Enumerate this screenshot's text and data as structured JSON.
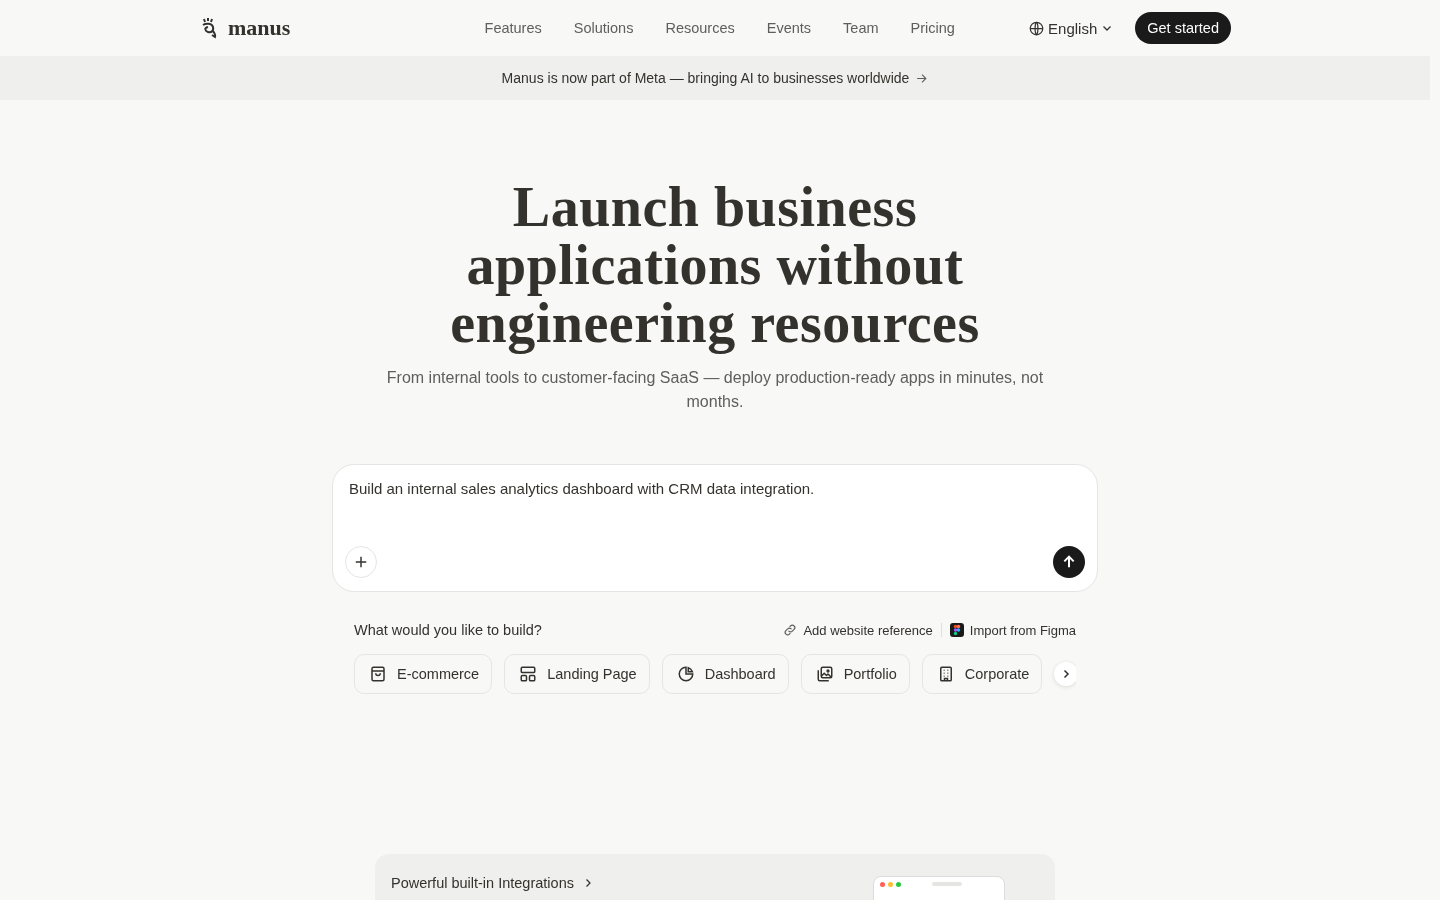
{
  "header": {
    "logo": "manus",
    "nav": [
      {
        "label": "Features"
      },
      {
        "label": "Solutions"
      },
      {
        "label": "Resources"
      },
      {
        "label": "Events"
      },
      {
        "label": "Team"
      },
      {
        "label": "Pricing"
      }
    ],
    "language": "English",
    "cta": "Get started"
  },
  "banner": {
    "text": "Manus is now part of Meta — bringing AI to businesses worldwide"
  },
  "hero": {
    "title": "Launch business applications without engineering resources",
    "subtitle": "From internal tools to customer-facing SaaS — deploy production-ready apps in minutes, not months."
  },
  "prompt": {
    "value": "Build an internal sales analytics dashboard with CRM data integration."
  },
  "build": {
    "question": "What would you like to build?",
    "actions": [
      {
        "kind": "link",
        "label": "Add website reference"
      },
      {
        "kind": "figma",
        "label": "Import from Figma"
      }
    ],
    "templates": [
      {
        "kind": "bag",
        "label": "E-commerce"
      },
      {
        "kind": "layout",
        "label": "Landing Page"
      },
      {
        "kind": "pie",
        "label": "Dashboard"
      },
      {
        "kind": "images",
        "label": "Portfolio"
      },
      {
        "kind": "building",
        "label": "Corporate"
      }
    ]
  },
  "integrations": {
    "title": "Powerful built-in Integrations"
  }
}
